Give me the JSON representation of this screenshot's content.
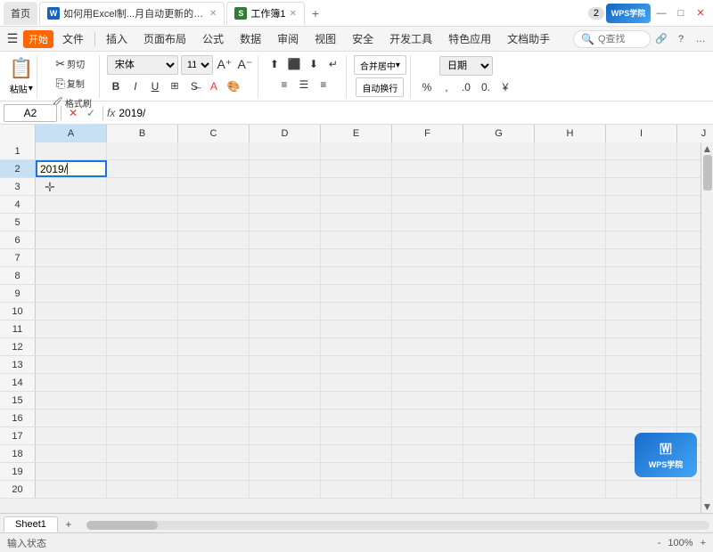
{
  "titlebar": {
    "home_label": "首页",
    "tab1_label": "如何用Excel制...月自动更新的考勤表",
    "tab2_label": "工作簿1",
    "tab1_icon": "W",
    "tab2_icon": "S",
    "add_btn": "+",
    "badge_num": "2",
    "wps_label": "WPS学院"
  },
  "menubar": {
    "items": [
      "文件",
      "插入",
      "页面布局",
      "公式",
      "数据",
      "审阅",
      "视图",
      "安全",
      "开发工具",
      "特色应用",
      "文档助手"
    ],
    "open_badge": "开始",
    "search_placeholder": "Q查找"
  },
  "toolbar": {
    "cut_label": "剪切",
    "copy_label": "复制",
    "format_label": "格式刷",
    "paste_label": "粘贴"
  },
  "fonttoolbar": {
    "font_name": "宋体",
    "font_size": "11",
    "bold": "B",
    "italic": "I",
    "underline": "U",
    "strikethrough": "S",
    "merge_label": "合并居中",
    "autowrap_label": "自动换行",
    "format_label": "日期"
  },
  "formulabar": {
    "cell_ref": "A2",
    "formula_value": "2019/"
  },
  "columns": [
    "A",
    "B",
    "C",
    "D",
    "E",
    "F",
    "G",
    "H",
    "I",
    "J"
  ],
  "rows": [
    1,
    2,
    3,
    4,
    5,
    6,
    7,
    8,
    9,
    10,
    11,
    12,
    13,
    14,
    15,
    16,
    17,
    18,
    19,
    20
  ],
  "active_cell": {
    "row": 2,
    "col": "A",
    "value": "2019/",
    "display": "2019/↵"
  },
  "sheettabs": {
    "active_tab": "Sheet1",
    "add_btn": "+"
  },
  "statusbar": {
    "status_text": "输入状态",
    "zoom_label": "100%"
  }
}
